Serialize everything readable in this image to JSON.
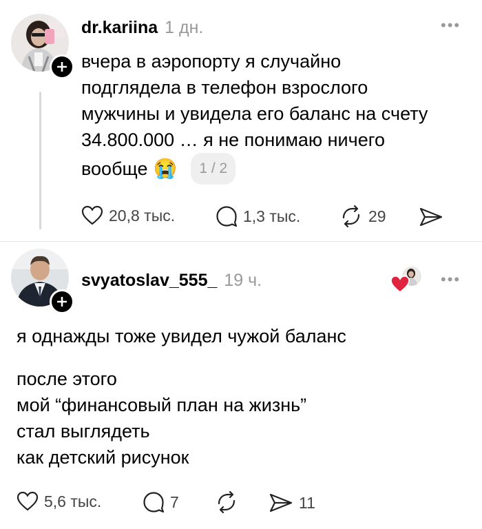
{
  "post1": {
    "username": "dr.kariina",
    "time": "1 дн.",
    "lines": [
      "вчера в аэропорту я случайно",
      "подглядела в телефон взрослого",
      "мужчины и увидела его баланс на счету",
      "34.800.000 … я не понимаю ничего"
    ],
    "last_line": "вообще",
    "emoji": "😭",
    "pager": "1 / 2",
    "likes": "20,8 тыс.",
    "comments": "1,3 тыс.",
    "reposts": "29"
  },
  "post2": {
    "username": "svyatoslav_555_",
    "time": "19 ч.",
    "line1": "я однажды тоже увидел чужой баланс",
    "lines": [
      "после этого",
      "мой “финансовый план на жизнь”",
      "стал выглядеть",
      "как детский рисунок"
    ],
    "likes": "5,6 тыс.",
    "comments": "7",
    "shares": "11"
  },
  "colors": {
    "heart_badge": "#e0243f",
    "muted": "#999999",
    "thread_line": "#d9d9d9"
  },
  "icons": [
    "more-icon",
    "heart-icon",
    "comment-icon",
    "repost-icon",
    "share-icon",
    "plus-icon"
  ]
}
